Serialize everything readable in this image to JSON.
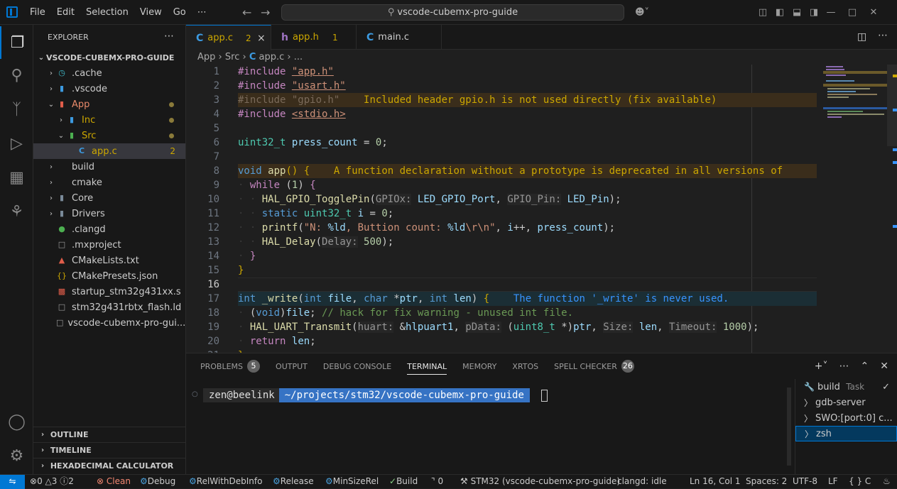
{
  "menu": [
    "File",
    "Edit",
    "Selection",
    "View",
    "Go",
    "⋯"
  ],
  "search": {
    "text": "vscode-cubemx-pro-guide"
  },
  "explorer": {
    "title": "EXPLORER",
    "more": "⋯",
    "root": "VSCODE-CUBEMX-PRO-GUIDE",
    "items": [
      {
        "label": ".cache"
      },
      {
        "label": ".vscode"
      },
      {
        "label": "App"
      },
      {
        "label": "Inc"
      },
      {
        "label": "Src"
      },
      {
        "label": "app.c",
        "badge": "2"
      },
      {
        "label": "build"
      },
      {
        "label": "cmake"
      },
      {
        "label": "Core"
      },
      {
        "label": "Drivers"
      },
      {
        "label": ".clangd"
      },
      {
        "label": ".mxproject"
      },
      {
        "label": "CMakeLists.txt"
      },
      {
        "label": "CMakePresets.json"
      },
      {
        "label": "startup_stm32g431xx.s"
      },
      {
        "label": "stm32g431rbtx_flash.ld"
      },
      {
        "label": "vscode-cubemx-pro-gui..."
      }
    ],
    "sections": [
      "OUTLINE",
      "TIMELINE",
      "HEXADECIMAL CALCULATOR"
    ]
  },
  "tabs": [
    {
      "label": "app.c",
      "count": "2",
      "icon": "C",
      "close": "×"
    },
    {
      "label": "app.h",
      "count": "1",
      "icon": "h"
    },
    {
      "label": "main.c",
      "icon": "C"
    }
  ],
  "breadcrumb": [
    "App",
    "Src",
    "app.c",
    "..."
  ],
  "editor": {
    "line_numbers": [
      "1",
      "2",
      "3",
      "4",
      "5",
      "6",
      "7",
      "8",
      "9",
      "10",
      "11",
      "12",
      "13",
      "14",
      "15",
      "16",
      "17",
      "18",
      "19",
      "20",
      "21"
    ],
    "current_line": "16",
    "diagnostics": {
      "line3": "Included header gpio.h is not used directly (fix available)",
      "line8": "A function declaration without a prototype is deprecated in all versions of",
      "line17": "The function '_write' is never used."
    }
  },
  "panel": {
    "tabs": [
      {
        "label": "PROBLEMS",
        "count": "5"
      },
      {
        "label": "OUTPUT"
      },
      {
        "label": "DEBUG CONSOLE"
      },
      {
        "label": "TERMINAL"
      },
      {
        "label": "MEMORY"
      },
      {
        "label": "XRTOS"
      },
      {
        "label": "SPELL CHECKER",
        "count": "26"
      }
    ],
    "prompt_user": "zen@beelink",
    "prompt_path": "~/projects/stm32/vscode-cubemx-pro-guide",
    "terminals": [
      {
        "label": "build",
        "sub": "Task",
        "check": "✓"
      },
      {
        "label": "gdb-server"
      },
      {
        "label": "SWO:[port:0] c..."
      },
      {
        "label": "zsh"
      }
    ]
  },
  "statusbar": {
    "errors": "0",
    "warnings": "3",
    "infos": "2",
    "clean": "Clean",
    "debug": "Debug",
    "relwithdebinfo": "RelWithDebInfo",
    "release": "Release",
    "minsizerel": "MinSizeRel",
    "build": "Build",
    "ports": "0",
    "target": "STM32 (vscode-cubemx-pro-guide)",
    "clangd": "clangd: idle",
    "cursor": "Ln 16, Col 1",
    "spaces": "Spaces: 2",
    "encoding": "UTF-8",
    "eol": "LF",
    "language": "{ } C"
  }
}
